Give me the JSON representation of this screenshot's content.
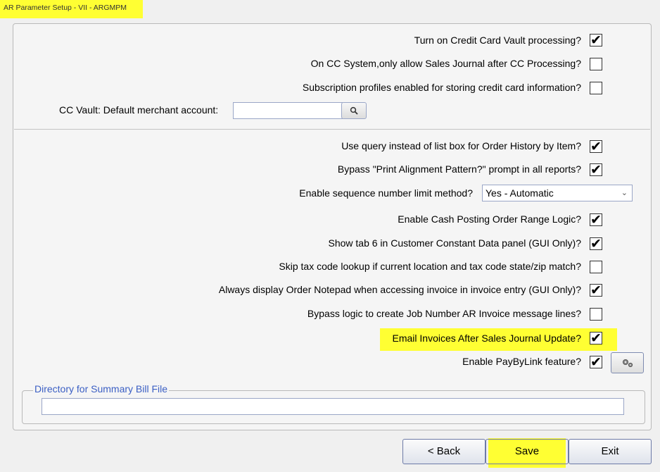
{
  "window": {
    "title": "AR Parameter Setup - VII - ARGMPM"
  },
  "options": [
    {
      "label": "Turn on Credit Card Vault processing?",
      "checked": true
    },
    {
      "label": "On CC System,only allow Sales Journal after CC Processing?",
      "checked": false
    },
    {
      "label": "Subscription profiles enabled for storing credit card information?",
      "checked": false
    },
    {
      "label": "Use query instead of list box for Order History by Item?",
      "checked": true
    },
    {
      "label": "Bypass \"Print Alignment Pattern?\" prompt in all reports?",
      "checked": true
    },
    {
      "label": "Enable Cash Posting Order Range Logic?",
      "checked": true
    },
    {
      "label": "Show tab 6 in Customer Constant Data panel (GUI Only)?",
      "checked": true
    },
    {
      "label": "Skip tax code lookup if current location and tax code state/zip match?",
      "checked": false
    },
    {
      "label": "Always display Order Notepad when accessing invoice in invoice entry (GUI Only)?",
      "checked": true
    },
    {
      "label": "Bypass logic to create Job Number AR Invoice message lines?",
      "checked": false
    },
    {
      "label": "Email Invoices After Sales Journal Update?",
      "checked": true
    },
    {
      "label": "Enable PayByLink feature?",
      "checked": true
    }
  ],
  "merchant": {
    "label": "CC Vault: Default merchant account:",
    "value": ""
  },
  "sequence": {
    "label": "Enable sequence number limit method?",
    "value": "Yes - Automatic"
  },
  "summary_bill": {
    "legend": "Directory for Summary Bill File",
    "value": ""
  },
  "buttons": {
    "back": "< Back",
    "save": "Save",
    "exit": "Exit"
  },
  "colors": {
    "highlight": "#ffff33",
    "legend": "#3b5fc4"
  }
}
